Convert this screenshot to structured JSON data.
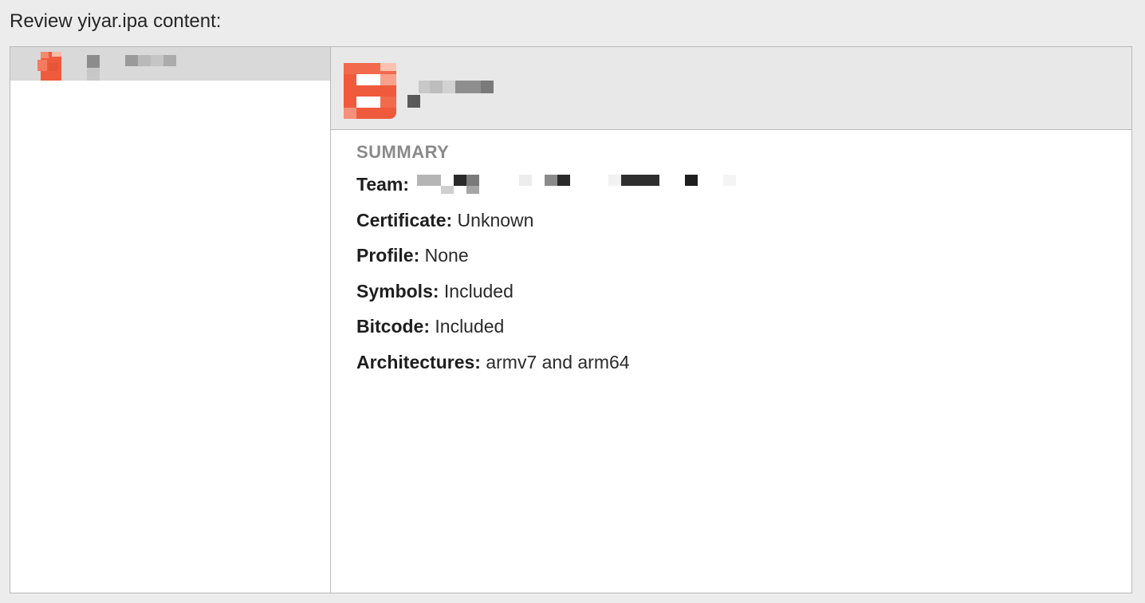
{
  "window": {
    "heading": "Review yiyar.ipa content:"
  },
  "sidebar": {
    "items": [
      {
        "icon": "app-icon",
        "label": "",
        "selected": true
      }
    ]
  },
  "detail": {
    "header": {
      "icon": "app-icon",
      "app_name": ""
    },
    "summary": {
      "title": "SUMMARY",
      "rows": [
        {
          "label": "Team:",
          "value": ""
        },
        {
          "label": "Certificate:",
          "value": "Unknown"
        },
        {
          "label": "Profile:",
          "value": "None"
        },
        {
          "label": "Symbols:",
          "value": "Included"
        },
        {
          "label": "Bitcode:",
          "value": "Included"
        },
        {
          "label": "Architectures:",
          "value": "armv7 and arm64"
        }
      ]
    }
  },
  "colors": {
    "accent_icon": "#f05a3c",
    "window_bg": "#ececec",
    "header_bg": "#e8e8e8",
    "selected_row": "#d9d9d9",
    "border": "#b9b9b9"
  }
}
